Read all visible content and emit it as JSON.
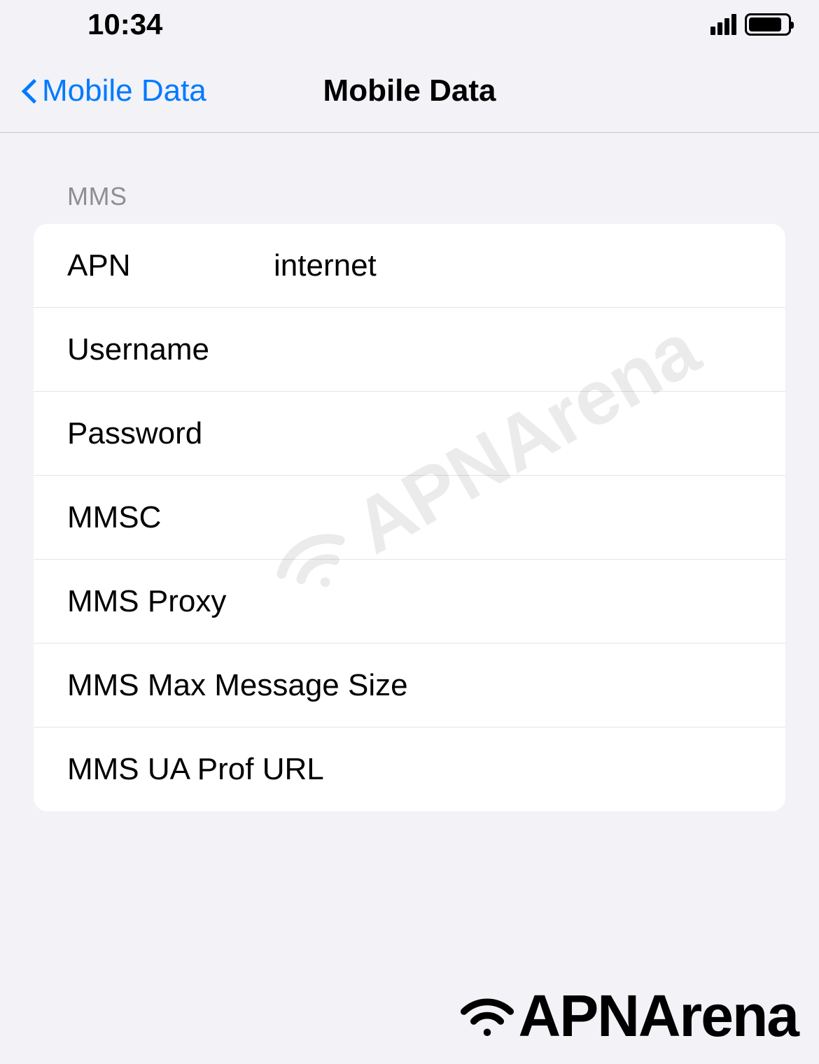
{
  "status_bar": {
    "time": "10:34"
  },
  "nav": {
    "back_label": "Mobile Data",
    "title": "Mobile Data"
  },
  "section": {
    "header": "MMS",
    "rows": [
      {
        "label": "APN",
        "value": "internet"
      },
      {
        "label": "Username",
        "value": ""
      },
      {
        "label": "Password",
        "value": ""
      },
      {
        "label": "MMSC",
        "value": ""
      },
      {
        "label": "MMS Proxy",
        "value": ""
      },
      {
        "label": "MMS Max Message Size",
        "value": ""
      },
      {
        "label": "MMS UA Prof URL",
        "value": ""
      }
    ]
  },
  "branding": {
    "name": "APNArena"
  }
}
